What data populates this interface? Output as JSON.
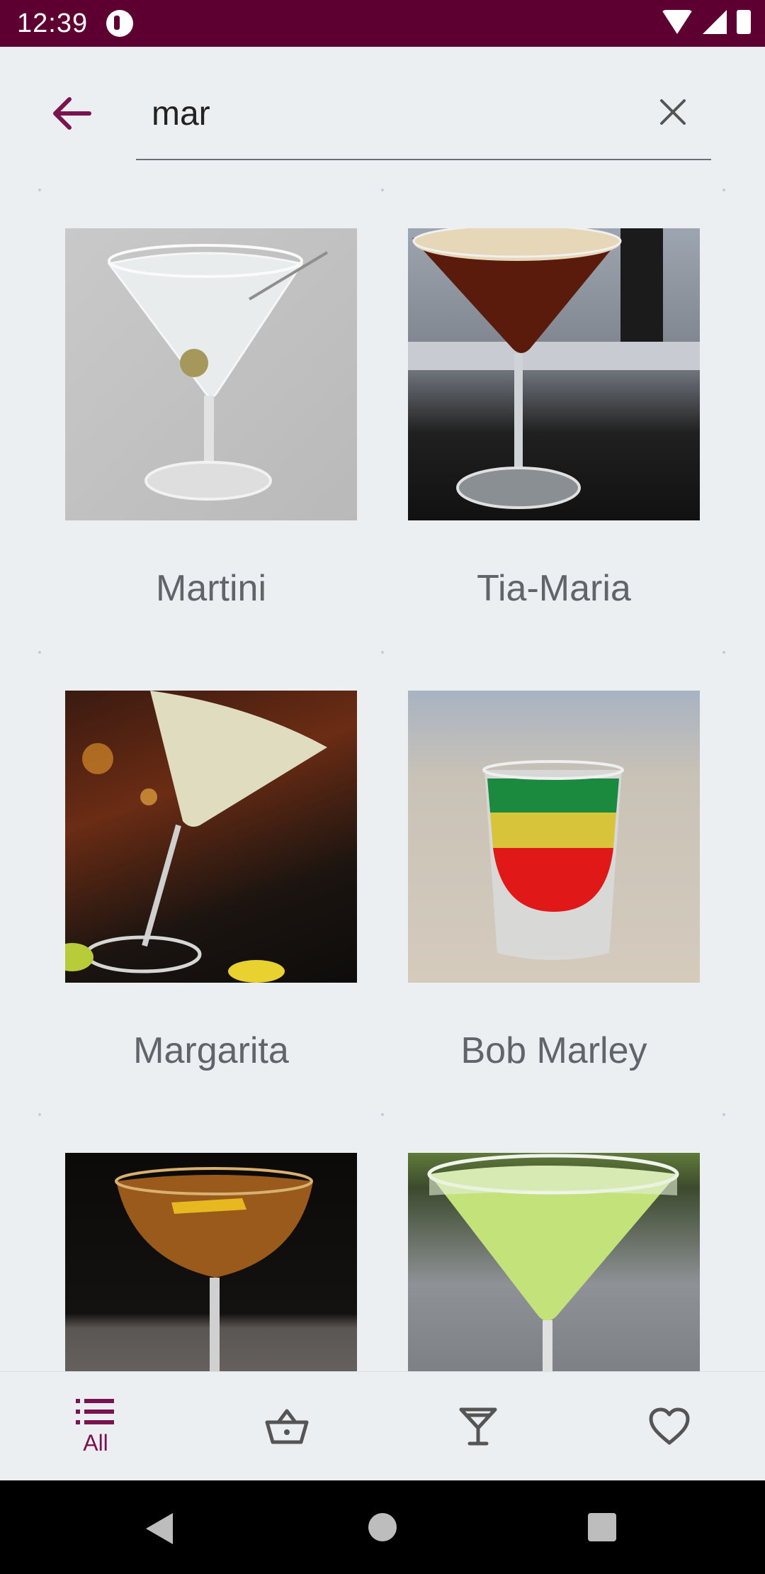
{
  "status_bar": {
    "time": "12:39"
  },
  "search": {
    "value": "mar"
  },
  "results": [
    {
      "name": "Martini"
    },
    {
      "name": "Tia-Maria"
    },
    {
      "name": "Margarita"
    },
    {
      "name": "Bob Marley"
    },
    {
      "name": ""
    },
    {
      "name": ""
    }
  ],
  "bottom_nav": {
    "all_label": "All"
  },
  "colors": {
    "accent": "#7a1450",
    "status_bar": "#5d0031",
    "background": "#eceff1"
  },
  "icons": {
    "back": "arrow-left-icon",
    "clear": "close-icon",
    "all": "list-icon",
    "basket": "basket-icon",
    "cocktail": "cocktail-glass-icon",
    "favorite": "heart-icon"
  }
}
